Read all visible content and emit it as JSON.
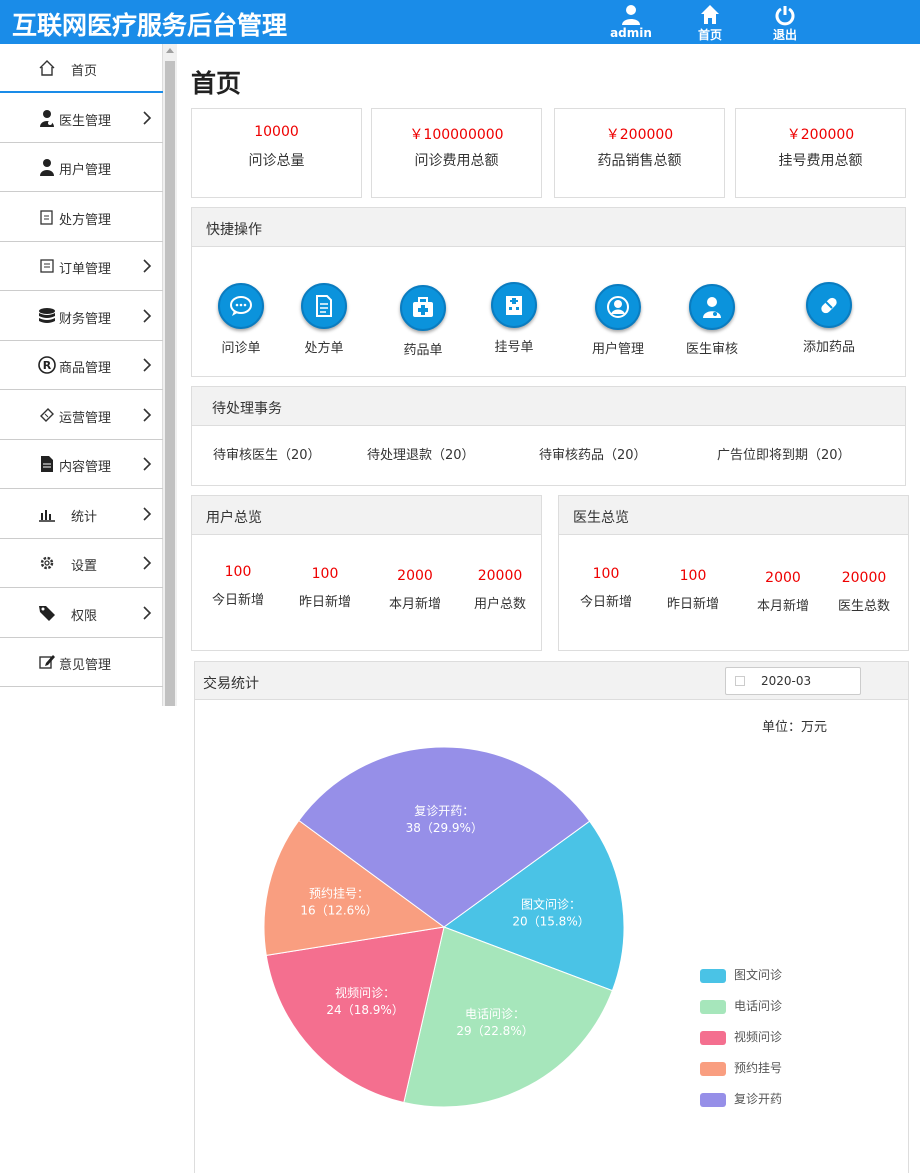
{
  "header": {
    "title": "互联网医疗服务后台管理",
    "user_label": "admin",
    "home_label": "首页",
    "logout_label": "退出"
  },
  "sidebar": {
    "items": [
      {
        "label": "首页",
        "icon": "home-icon"
      },
      {
        "label": "医生管理",
        "icon": "doctor-icon"
      },
      {
        "label": "用户管理",
        "icon": "user-icon"
      },
      {
        "label": "处方管理",
        "icon": "prescription-icon"
      },
      {
        "label": "订单管理",
        "icon": "order-icon"
      },
      {
        "label": "财务管理",
        "icon": "database-icon"
      },
      {
        "label": "商品管理",
        "icon": "registered-icon"
      },
      {
        "label": "运营管理",
        "icon": "ticket-icon"
      },
      {
        "label": "内容管理",
        "icon": "document-icon"
      },
      {
        "label": "统计",
        "icon": "bar-chart-icon"
      },
      {
        "label": "设置",
        "icon": "gear-icon"
      },
      {
        "label": "权限",
        "icon": "tag-icon"
      },
      {
        "label": "意见管理",
        "icon": "edit-icon"
      }
    ]
  },
  "page": {
    "title": "首页"
  },
  "stats": [
    {
      "value": "10000",
      "label": "问诊总量"
    },
    {
      "value": "￥100000000",
      "label": "问诊费用总额"
    },
    {
      "value": "￥200000",
      "label": "药品销售总额"
    },
    {
      "value": "￥200000",
      "label": "挂号费用总额"
    }
  ],
  "quick_actions": {
    "title": "快捷操作",
    "items": [
      {
        "label": "问诊单",
        "icon": "chat-icon"
      },
      {
        "label": "处方单",
        "icon": "prescription-doc-icon"
      },
      {
        "label": "药品单",
        "icon": "medkit-icon"
      },
      {
        "label": "挂号单",
        "icon": "hospital-icon"
      },
      {
        "label": "用户管理",
        "icon": "user-circle-icon"
      },
      {
        "label": "医生审核",
        "icon": "doctor-icon"
      },
      {
        "label": "添加药品",
        "icon": "pill-icon"
      }
    ]
  },
  "pending": {
    "title": "待处理事务",
    "items": [
      "待审核医生（20）",
      "待处理退款（20）",
      "待审核药品（20）",
      "广告位即将到期（20）"
    ]
  },
  "user_overview": {
    "title": "用户总览",
    "items": [
      {
        "value": "100",
        "label": "今日新增"
      },
      {
        "value": "100",
        "label": "昨日新增"
      },
      {
        "value": "2000",
        "label": "本月新增"
      },
      {
        "value": "20000",
        "label": "用户总数"
      }
    ]
  },
  "doctor_overview": {
    "title": "医生总览",
    "items": [
      {
        "value": "100",
        "label": "今日新增"
      },
      {
        "value": "100",
        "label": "昨日新增"
      },
      {
        "value": "2000",
        "label": "本月新增"
      },
      {
        "value": "20000",
        "label": "医生总数"
      }
    ]
  },
  "trade": {
    "title": "交易统计",
    "date": "2020-03",
    "unit": "单位：万元"
  },
  "colors": {
    "header": "#1a8ce8",
    "accent_red": "#ee0000",
    "icon_blue": "#0b93dc"
  },
  "chart_data": {
    "type": "pie",
    "title": "",
    "slices": [
      {
        "name": "图文问诊",
        "value": 20,
        "label": "图文问诊：",
        "pct": "20（15.8%）",
        "color": "#4ac3e6"
      },
      {
        "name": "电话问诊",
        "value": 29,
        "label": "电话问诊：",
        "pct": "29（22.8%）",
        "color": "#a6e6bb"
      },
      {
        "name": "视频问诊",
        "value": 24,
        "label": "视频问诊：",
        "pct": "24（18.9%）",
        "color": "#f46f8f"
      },
      {
        "name": "预约挂号",
        "value": 16,
        "label": "预约挂号：",
        "pct": "16（12.6%）",
        "color": "#f99e80"
      },
      {
        "name": "复诊开药",
        "value": 38,
        "label": "复诊开药：",
        "pct": "38（29.9%）",
        "color": "#968fe8"
      }
    ],
    "legend_position": "bottom-right"
  }
}
